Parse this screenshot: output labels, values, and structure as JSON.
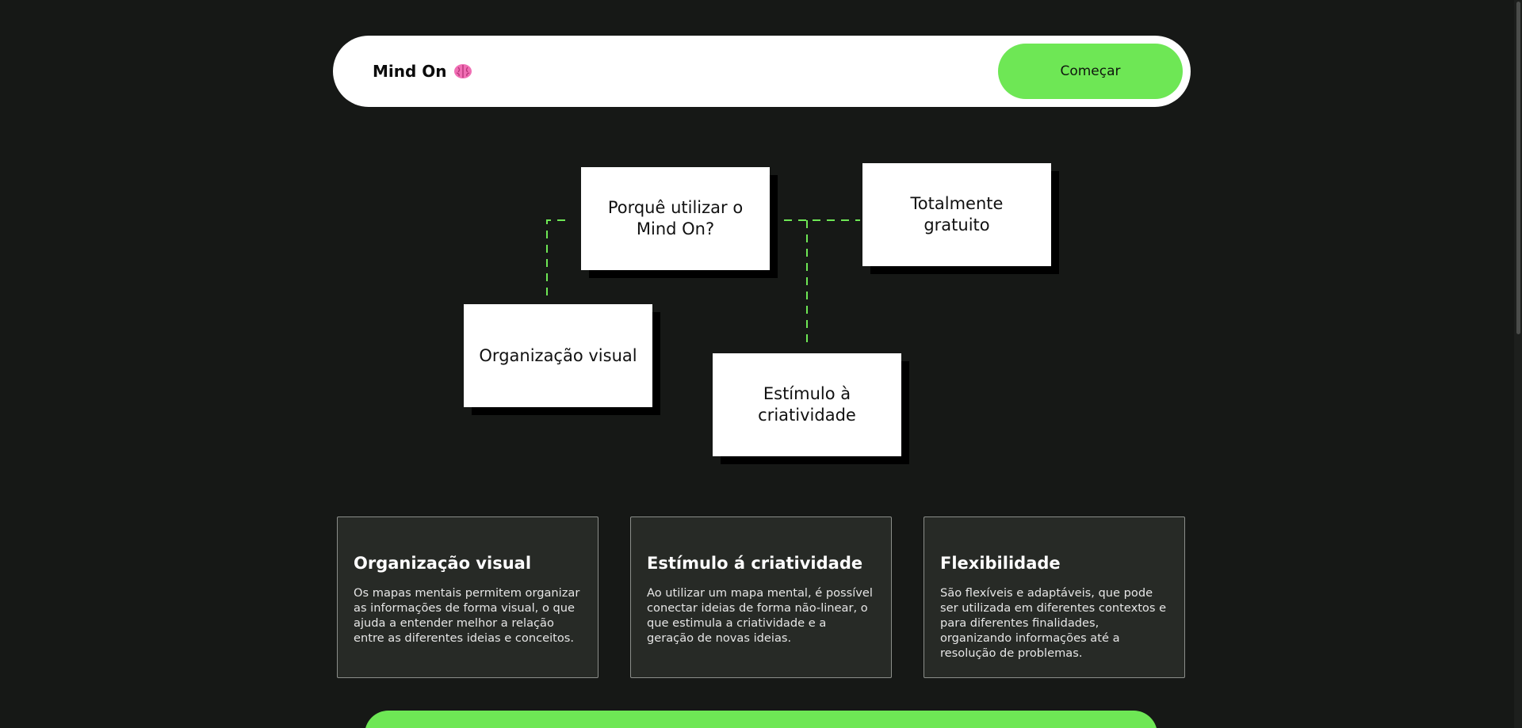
{
  "header": {
    "brand": "Mind On",
    "brand_icon": "brain-icon",
    "start_button": "Começar"
  },
  "mind_map": {
    "center": "Porquê utilizar o Mind On?",
    "nodes": [
      "Totalmente gratuito",
      "Organização visual",
      "Estímulo à criatividade"
    ]
  },
  "features": [
    {
      "title": "Organização visual",
      "text": "Os mapas mentais permitem organizar as informações de forma visual, o que ajuda a entender melhor a relação entre as diferentes ideias e conceitos."
    },
    {
      "title": "Estímulo á criatividade",
      "text": "Ao utilizar um mapa mental, é possível conectar ideias de forma não-linear, o que estimula a criatividade e a geração de novas ideias."
    },
    {
      "title": "Flexibilidade",
      "text": "São flexíveis e adaptáveis, que pode ser utilizada em diferentes contextos e para diferentes finalidades, organizando informações até a resolução de problemas."
    }
  ],
  "colors": {
    "background": "#161816",
    "accent": "#6ee755",
    "card_bg": "#272a26"
  }
}
